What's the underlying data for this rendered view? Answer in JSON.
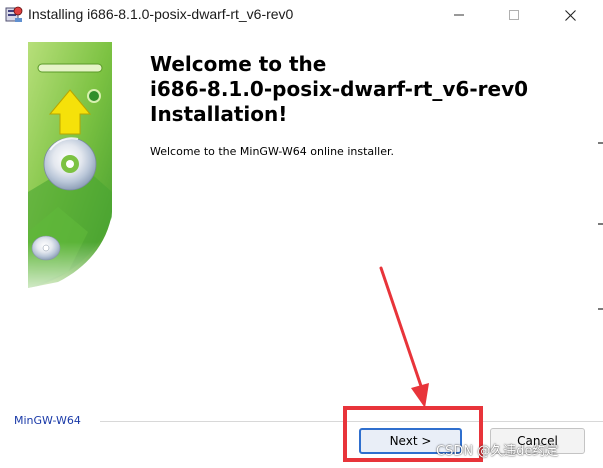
{
  "window": {
    "title": "Installing i686-8.1.0-posix-dwarf-rt_v6-rev0"
  },
  "welcome": {
    "title_line1": "Welcome to the",
    "title_line2": "i686-8.1.0-posix-dwarf-rt_v6-rev0",
    "title_line3": "Installation!",
    "text": "Welcome to the MinGW-W64 online installer."
  },
  "footer": {
    "brand": "MinGW-W64"
  },
  "buttons": {
    "next_label": "Next >",
    "cancel_label": "Cancel"
  },
  "watermark": {
    "text": "CSDN @久违de约定"
  },
  "icons": {
    "app": "installer-icon",
    "banner": "cd-install-banner",
    "minimize": "minimize-icon",
    "maximize": "maximize-icon",
    "close": "close-icon"
  },
  "colors": {
    "banner_green": "#7cc242",
    "banner_dark_green": "#3f9a2c",
    "arrow_yellow": "#f5e10a",
    "highlight_red": "#e8343a",
    "footer_brand_blue": "#1a3aa8",
    "primary_button_border": "#2f6fce"
  }
}
